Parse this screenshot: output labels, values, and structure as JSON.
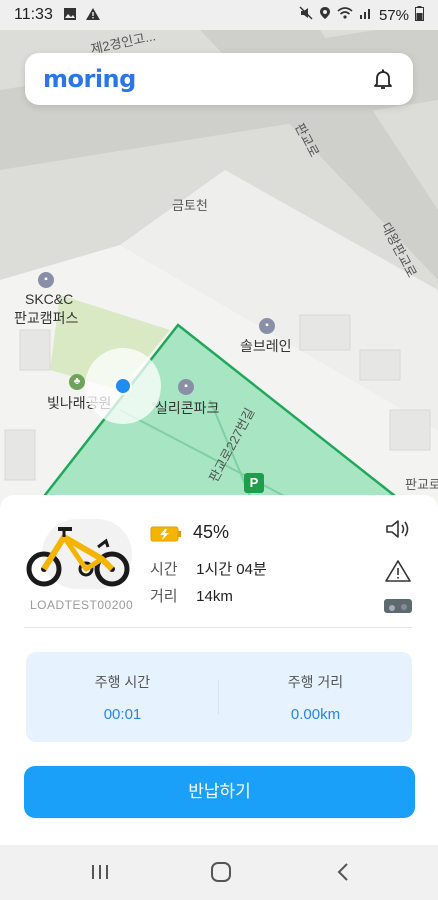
{
  "status_bar": {
    "time": "11:33",
    "battery_percent": "57%",
    "icons": [
      "gallery-icon",
      "warning-icon",
      "mute-icon",
      "location-icon",
      "wifi-icon",
      "signal-icon",
      "battery-icon"
    ]
  },
  "header": {
    "logo": "moring",
    "bell_icon": "bell-icon"
  },
  "map": {
    "labels": {
      "road_top": "제2경인고...",
      "creek": "금토천",
      "skcc_line1": "SKC&C",
      "skcc_line2": "판교캠퍼스",
      "solbrain": "솔브레인",
      "bitnarae": "빛나래공원",
      "silicon_park": "실리콘파크",
      "road_227": "판교로227번길",
      "road_right": "대왕판교로",
      "road_top_right": "판교로",
      "road_bottom_right": "판교로..."
    },
    "parking_label": "P",
    "colors": {
      "zone_fill": "#8fe0b3",
      "zone_stroke": "#1fa85a",
      "location": "#1f8cf0"
    }
  },
  "vehicle": {
    "id": "LOADTEST00200",
    "battery_level": 0.45,
    "battery_text": "45%",
    "time_label": "시간",
    "time_value": "1시간 04분",
    "distance_label": "거리",
    "distance_value": "14km",
    "side_icons": [
      "speaker-icon",
      "warning-triangle-icon",
      "vehicle-photo-icon"
    ]
  },
  "ride": {
    "time_title": "주행 시간",
    "time_value": "00:01",
    "distance_title": "주행 거리",
    "distance_value": "0.00km"
  },
  "return_button": "반납하기",
  "nav": {
    "buttons": [
      "recent-apps-icon",
      "home-icon",
      "back-icon"
    ]
  }
}
